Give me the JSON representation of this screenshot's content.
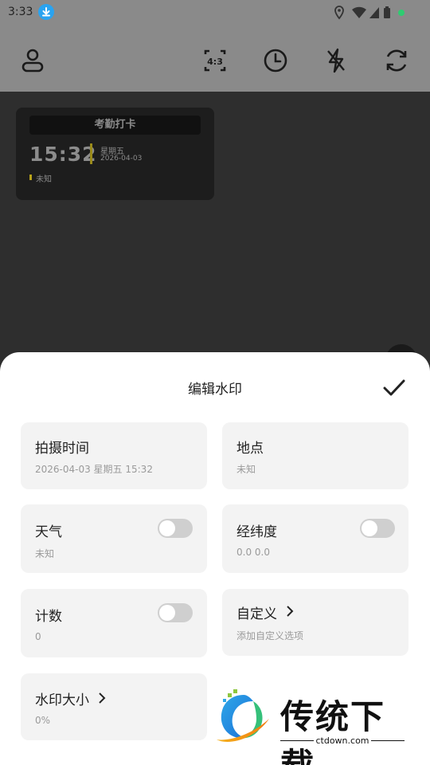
{
  "status_bar": {
    "time": "3:33"
  },
  "watermark": {
    "title": "考勤打卡",
    "time": "15:32",
    "weekday": "星期五",
    "date": "2026-04-03",
    "location": "未知"
  },
  "sheet": {
    "title": "编辑水印",
    "cards": {
      "shoot_time": {
        "label": "拍摄时间",
        "value": "2026-04-03 星期五 15:32"
      },
      "location": {
        "label": "地点",
        "value": "未知"
      },
      "weather": {
        "label": "天气",
        "value": "未知",
        "enabled": false
      },
      "latlng": {
        "label": "经纬度",
        "value": "0.0 0.0",
        "enabled": false
      },
      "counter": {
        "label": "计数",
        "value": "0",
        "enabled": false
      },
      "custom": {
        "label": "自定义",
        "value": "添加自定义选项"
      },
      "size": {
        "label": "水印大小",
        "value": "0%"
      }
    }
  },
  "overlay_logo": {
    "brand": "传统下载",
    "url": "ctdown.com"
  },
  "icons": [
    "download-icon",
    "location-icon",
    "wifi-icon",
    "signal-icon",
    "battery-icon",
    "user-icon",
    "aspect-ratio-icon",
    "timer-icon",
    "flash-off-icon",
    "switch-camera-icon",
    "check-icon",
    "chevron-right-icon"
  ],
  "colors": {
    "accent_dot": "#2ecc71",
    "watermark_bar": "#9a8a1a",
    "download_badge": "#2aa3f0"
  }
}
